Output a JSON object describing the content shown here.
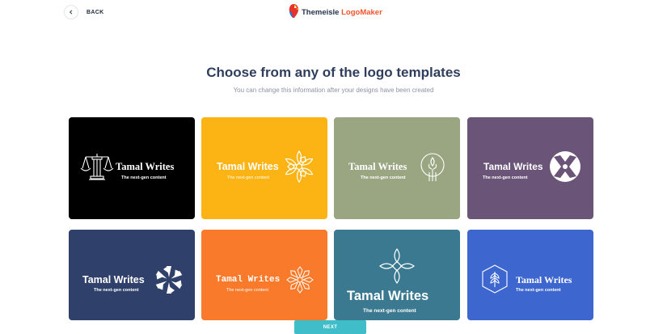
{
  "header": {
    "back_label": "BACK",
    "brand_part1": "Themeisle",
    "brand_part2": "LogoMaker"
  },
  "main": {
    "title": "Choose from any of the logo templates",
    "subtitle": "You can change this information after your designs have been created"
  },
  "templates": [
    {
      "name": "Tamal Writes",
      "tagline": "The next-gen content",
      "background": "#000000",
      "icon": "columns-scale-icon"
    },
    {
      "name": "Tamal Writes",
      "tagline": "The next-gen content",
      "background": "#fbb413",
      "icon": "flower-icon"
    },
    {
      "name": "Tamal Writes",
      "tagline": "The next-gen content",
      "background": "#9aa682",
      "icon": "wheat-circle-icon"
    },
    {
      "name": "Tamal Writes",
      "tagline": "The next-gen content",
      "background": "#6a5478",
      "icon": "x-circle-icon"
    },
    {
      "name": "Tamal Writes",
      "tagline": "The next-gen content",
      "background": "#2f416a",
      "icon": "snowflake-icon"
    },
    {
      "name": "Tamal Writes",
      "tagline": "The next-gen content",
      "background": "#f97a2a",
      "icon": "sun-burst-icon"
    },
    {
      "name": "Tamal Writes",
      "tagline": "The next-gen content",
      "background": "#3b7990",
      "icon": "leaf-knot-icon"
    },
    {
      "name": "Tamal Writes",
      "tagline": "The next-gen content",
      "background": "#3d66cf",
      "icon": "wheat-hexagon-icon"
    }
  ],
  "footer": {
    "next_label": "NEXT",
    "next_color": "#3fbdc8"
  }
}
